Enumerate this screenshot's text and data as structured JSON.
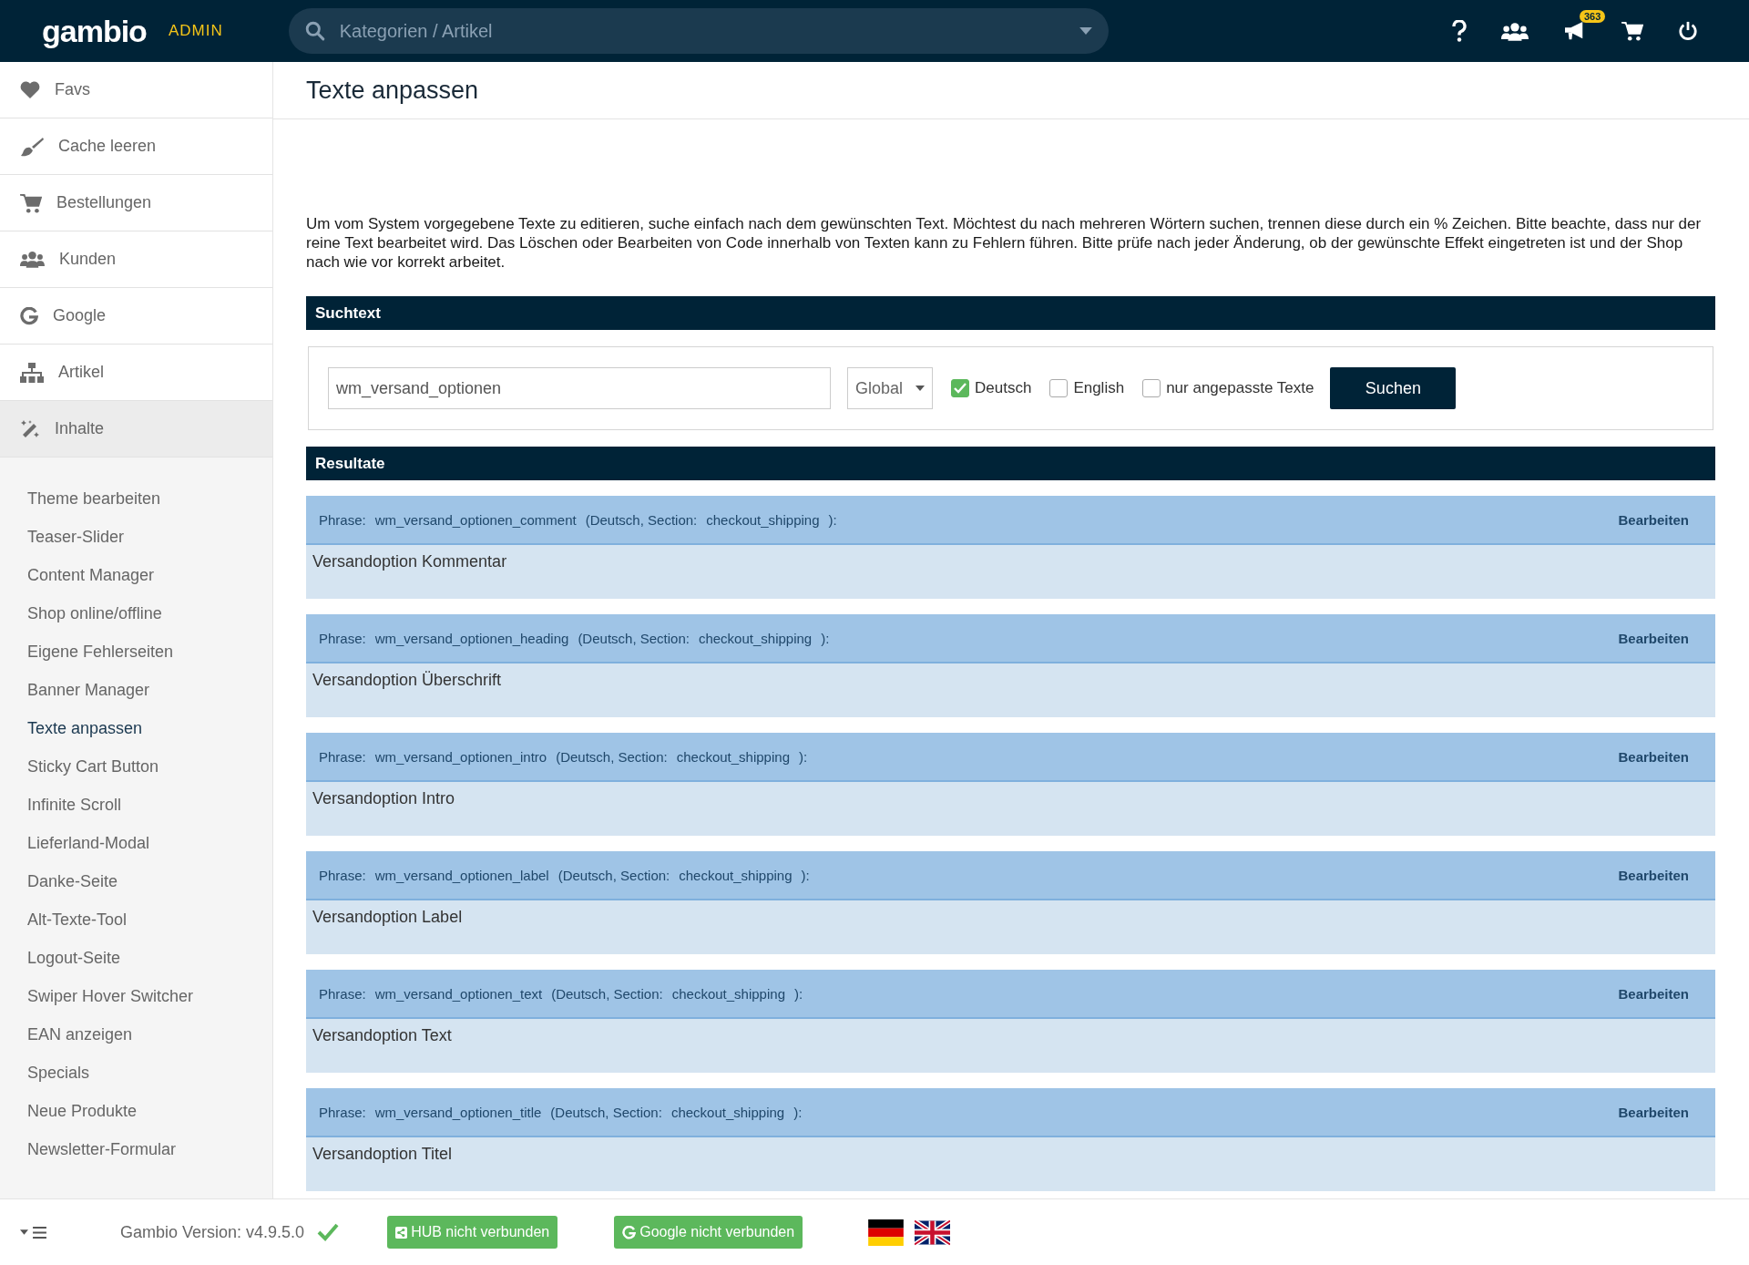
{
  "topbar": {
    "logo": "gambio",
    "admin_label": "ADMIN",
    "search": {
      "placeholder": "Kategorien / Artikel"
    },
    "notification_count": "363"
  },
  "sidebar": {
    "items": [
      {
        "label": "Favs",
        "selected": false
      },
      {
        "label": "Cache leeren",
        "selected": false
      },
      {
        "label": "Bestellungen",
        "selected": false
      },
      {
        "label": "Kunden",
        "selected": false
      },
      {
        "label": "Google",
        "selected": false
      },
      {
        "label": "Artikel",
        "selected": false
      },
      {
        "label": "Inhalte",
        "selected": true
      }
    ],
    "subitems": [
      {
        "label": "Theme bearbeiten",
        "selected": false
      },
      {
        "label": "Teaser-Slider",
        "selected": false
      },
      {
        "label": "Content Manager",
        "selected": false
      },
      {
        "label": "Shop online/offline",
        "selected": false
      },
      {
        "label": "Eigene Fehlerseiten",
        "selected": false
      },
      {
        "label": "Banner Manager",
        "selected": false
      },
      {
        "label": "Texte anpassen",
        "selected": true
      },
      {
        "label": "Sticky Cart Button",
        "selected": false
      },
      {
        "label": "Infinite Scroll",
        "selected": false
      },
      {
        "label": "Lieferland-Modal",
        "selected": false
      },
      {
        "label": "Danke-Seite",
        "selected": false
      },
      {
        "label": "Alt-Texte-Tool",
        "selected": false
      },
      {
        "label": "Logout-Seite",
        "selected": false
      },
      {
        "label": "Swiper Hover Switcher",
        "selected": false
      },
      {
        "label": "EAN anzeigen",
        "selected": false
      },
      {
        "label": "Specials",
        "selected": false
      },
      {
        "label": "Neue Produkte",
        "selected": false
      },
      {
        "label": "Newsletter-Formular",
        "selected": false
      }
    ]
  },
  "page": {
    "title": "Texte anpassen",
    "description": "Um vom System vorgegebene Texte zu editieren, suche einfach nach dem gewünschten Text. Möchtest du nach mehreren Wörtern suchen, trennen diese durch ein % Zeichen. Bitte beachte, dass nur der reine Text bearbeitet wird. Das Löschen oder Bearbeiten von Code innerhalb von Texten kann zu Fehlern führen. Bitte prüfe nach jeder Änderung, ob der gewünschte Effekt eingetreten ist und der Shop nach wie vor korrekt arbeitet."
  },
  "search_section": {
    "heading": "Suchtext",
    "query": "wm_versand_optionen",
    "scope": "Global",
    "options": [
      {
        "label": "Deutsch",
        "checked": true
      },
      {
        "label": "English",
        "checked": false
      },
      {
        "label": "nur angepasste Texte",
        "checked": false
      }
    ],
    "button": "Suchen"
  },
  "results_section": {
    "heading": "Resultate",
    "results": [
      {
        "phrase_label": "Phrase:",
        "key": "wm_versand_optionen_comment",
        "language_section": "(Deutsch, Section:",
        "section": "checkout_shipping",
        "close": "):",
        "action": "Bearbeiten",
        "text": "Versandoption Kommentar"
      },
      {
        "phrase_label": "Phrase:",
        "key": "wm_versand_optionen_heading",
        "language_section": "(Deutsch, Section:",
        "section": "checkout_shipping",
        "close": "):",
        "action": "Bearbeiten",
        "text": "Versandoption Überschrift"
      },
      {
        "phrase_label": "Phrase:",
        "key": "wm_versand_optionen_intro",
        "language_section": "(Deutsch, Section:",
        "section": "checkout_shipping",
        "close": "):",
        "action": "Bearbeiten",
        "text": "Versandoption Intro"
      },
      {
        "phrase_label": "Phrase:",
        "key": "wm_versand_optionen_label",
        "language_section": "(Deutsch, Section:",
        "section": "checkout_shipping",
        "close": "):",
        "action": "Bearbeiten",
        "text": "Versandoption Label"
      },
      {
        "phrase_label": "Phrase:",
        "key": "wm_versand_optionen_text",
        "language_section": "(Deutsch, Section:",
        "section": "checkout_shipping",
        "close": "):",
        "action": "Bearbeiten",
        "text": "Versandoption Text"
      },
      {
        "phrase_label": "Phrase:",
        "key": "wm_versand_optionen_title",
        "language_section": "(Deutsch, Section:",
        "section": "checkout_shipping",
        "close": "):",
        "action": "Bearbeiten",
        "text": "Versandoption Titel"
      }
    ]
  },
  "footer": {
    "version": "Gambio Version: v4.9.5.0",
    "hub_button": "HUB nicht verbunden",
    "google_button": "Google nicht verbunden"
  }
}
